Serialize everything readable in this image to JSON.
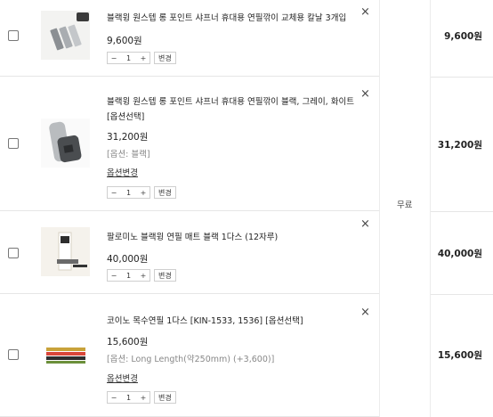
{
  "items": [
    {
      "name": "블랙윙 원스텝 롱 포인트 샤프너 휴대용 연필깎이 교체용 칼날 3개입",
      "price": "9,600원",
      "qty": "1",
      "qty_change_label": "변경",
      "total": "9,600원"
    },
    {
      "name": "블랙윙 원스텝 롱 포인트 샤프너 휴대용 연필깎이 블랙, 그레이, 화이트 [옵션선택]",
      "price": "31,200원",
      "option": "[옵션: 블랙]",
      "option_change": "옵션변경",
      "qty": "1",
      "qty_change_label": "변경",
      "total": "31,200원"
    },
    {
      "name": "팔로미노 블랙윙 연필 매트 블랙 1다스 (12자루)",
      "price": "40,000원",
      "qty": "1",
      "qty_change_label": "변경",
      "total": "40,000원"
    },
    {
      "name": "코이노 목수연필 1다스 [KIN-1533, 1536] [옵션선택]",
      "price": "15,600원",
      "option": "[옵션: Long Length(약250mm) (+3,600)]",
      "option_change": "옵션변경",
      "qty": "1",
      "qty_change_label": "변경",
      "total": "15,600원"
    }
  ],
  "shipping": "무료",
  "icons": {
    "remove": "close-icon",
    "minus": "minus-icon",
    "plus": "plus-icon"
  },
  "stepper_symbols": {
    "minus": "−",
    "plus": "+"
  },
  "close_symbol": "×"
}
